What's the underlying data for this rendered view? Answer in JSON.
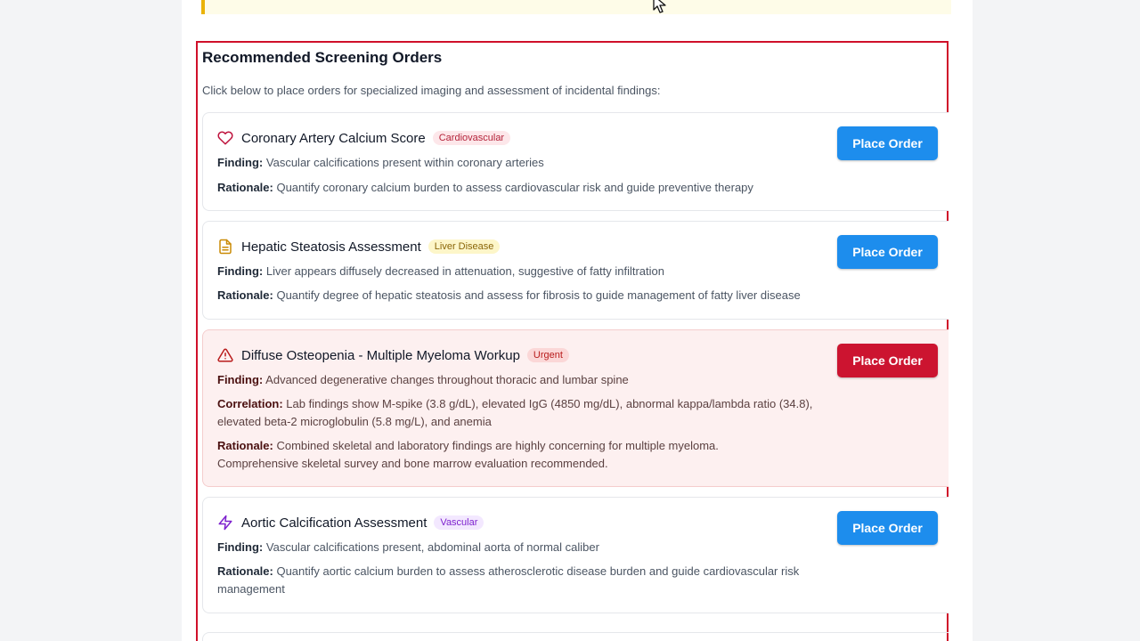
{
  "section": {
    "title": "Recommended Screening Orders",
    "description": "Click below to place orders for specialized imaging and assessment of incidental findings:"
  },
  "cards": [
    {
      "title": "Coronary Artery Calcium Score",
      "badge": "Cardiovascular",
      "icon": "heart-icon",
      "finding_label": "Finding:",
      "finding": "Vascular calcifications present within coronary arteries",
      "rationale_label": "Rationale:",
      "rationale": "Quantify coronary calcium burden to assess cardiovascular risk and guide preventive therapy",
      "button": "Place Order"
    },
    {
      "title": "Hepatic Steatosis Assessment",
      "badge": "Liver Disease",
      "icon": "document-icon",
      "finding_label": "Finding:",
      "finding": "Liver appears diffusely decreased in attenuation, suggestive of fatty infiltration",
      "rationale_label": "Rationale:",
      "rationale": "Quantify degree of hepatic steatosis and assess for fibrosis to guide management of fatty liver disease",
      "button": "Place Order"
    },
    {
      "title": "Diffuse Osteopenia - Multiple Myeloma Workup",
      "badge": "Urgent",
      "icon": "warning-triangle-icon",
      "finding_label": "Finding:",
      "finding": "Advanced degenerative changes throughout thoracic and lumbar spine",
      "correlation_label": "Correlation:",
      "correlation": "Lab findings show M-spike (3.8 g/dL), elevated IgG (4850 mg/dL), abnormal kappa/lambda ratio (34.8), elevated beta-2 microglobulin (5.8 mg/L), and anemia",
      "rationale_label": "Rationale:",
      "rationale": "Combined skeletal and laboratory findings are highly concerning for multiple myeloma. Comprehensive skeletal survey and bone marrow evaluation recommended.",
      "button": "Place Order"
    },
    {
      "title": "Aortic Calcification Assessment",
      "badge": "Vascular",
      "icon": "lightning-icon",
      "finding_label": "Finding:",
      "finding": "Vascular calcifications present, abdominal aorta of normal caliber",
      "rationale_label": "Rationale:",
      "rationale": "Quantify aortic calcium burden to assess atherosclerotic disease burden and guide cardiovascular risk management",
      "button": "Place Order"
    }
  ],
  "colors": {
    "accent_blue": "#1d8ded",
    "urgent_red": "#cc1430",
    "section_border": "#d0102a",
    "notice_border": "#eab308"
  }
}
